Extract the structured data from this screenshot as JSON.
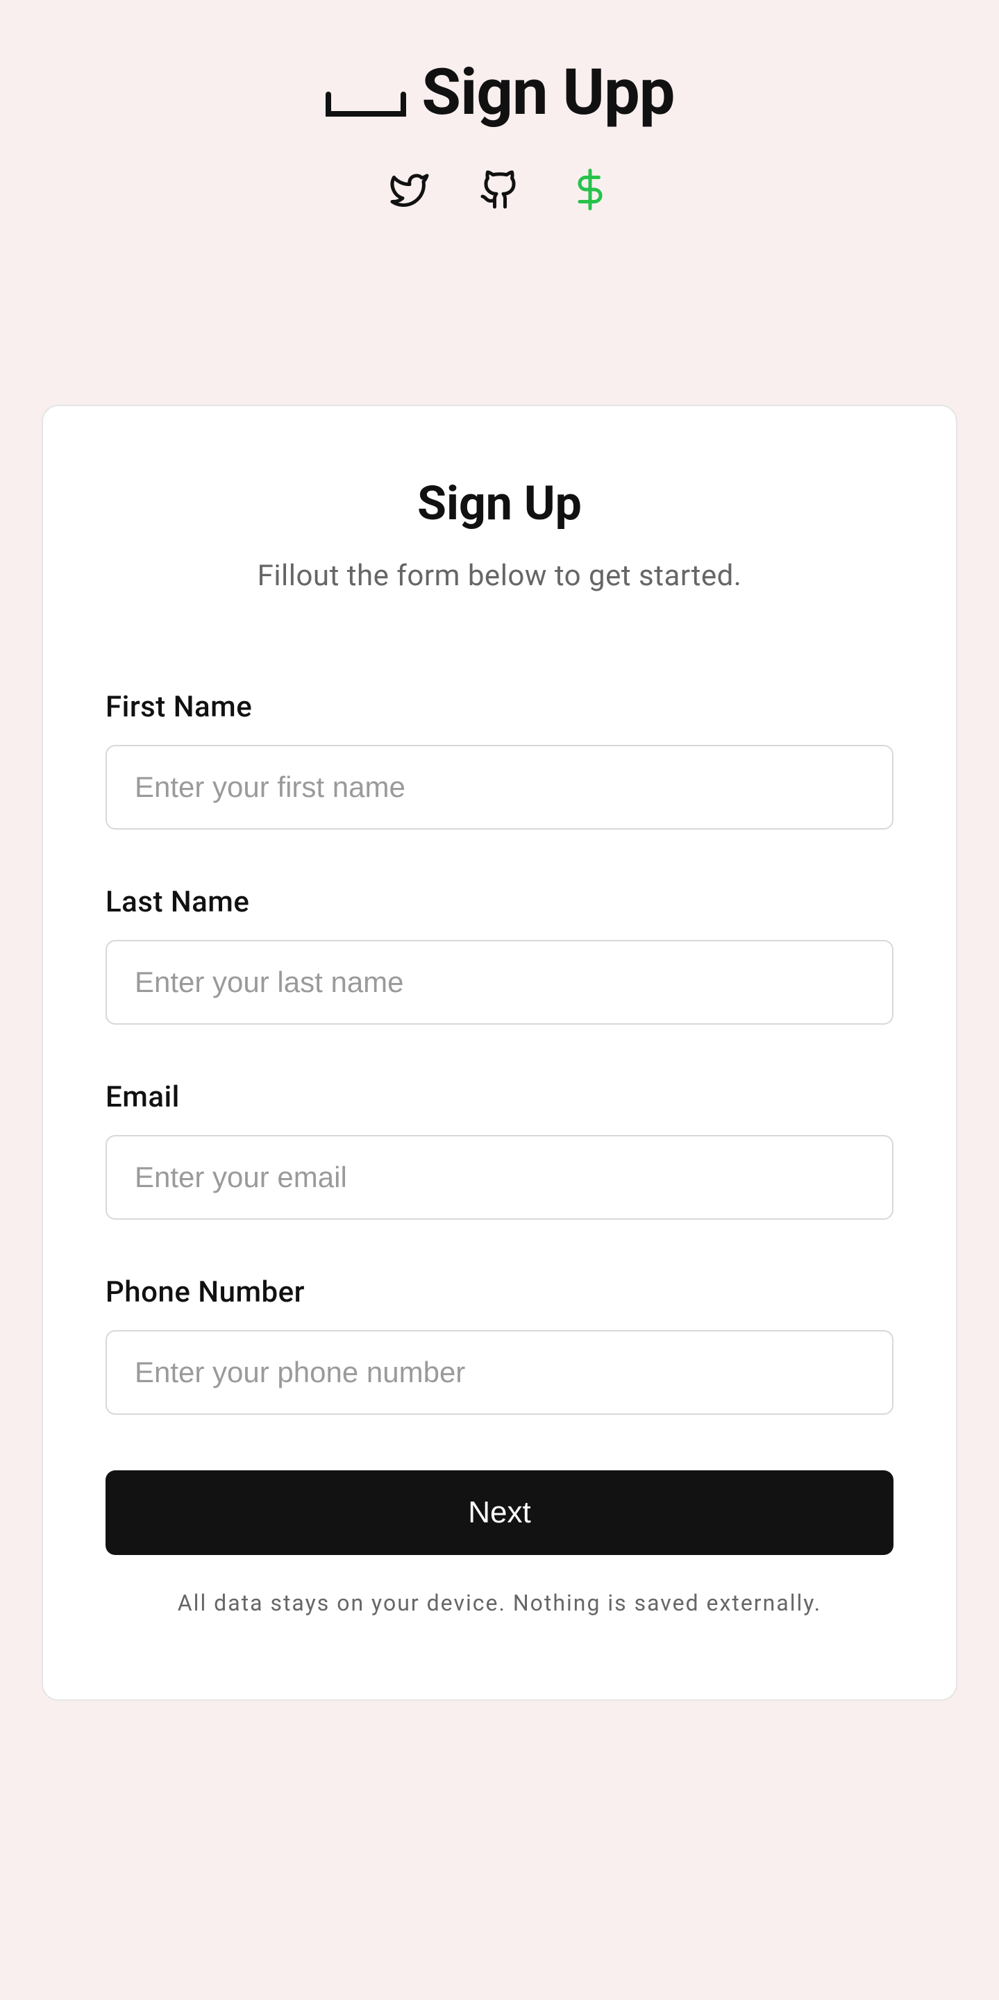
{
  "header": {
    "title": "Sign Upp",
    "social": [
      {
        "name": "twitter"
      },
      {
        "name": "github"
      },
      {
        "name": "dollar"
      }
    ]
  },
  "card": {
    "title": "Sign Up",
    "subtitle": "Fillout the form below to get started.",
    "disclaimer": "All data stays on your device. Nothing is saved externally.",
    "next_label": "Next"
  },
  "form": {
    "first_name": {
      "label": "First Name",
      "placeholder": "Enter your first name",
      "value": ""
    },
    "last_name": {
      "label": "Last Name",
      "placeholder": "Enter your last name",
      "value": ""
    },
    "email": {
      "label": "Email",
      "placeholder": "Enter your email",
      "value": ""
    },
    "phone": {
      "label": "Phone Number",
      "placeholder": "Enter your phone number",
      "value": ""
    }
  }
}
